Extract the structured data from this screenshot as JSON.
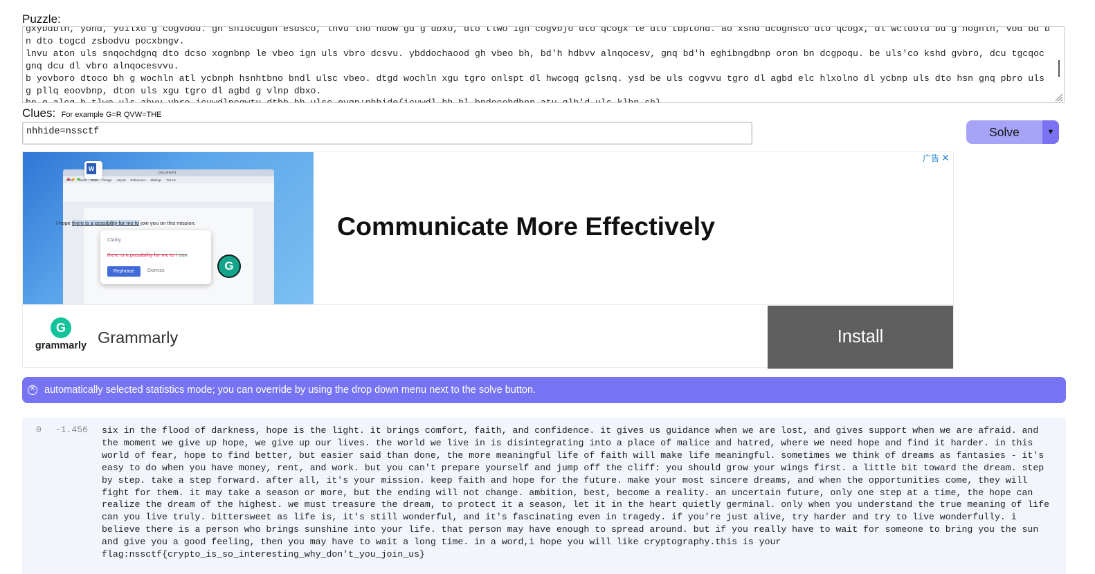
{
  "puzzle": {
    "label": "Puzzle:",
    "text": "gxybdbln, yond, yoilxo g cogvbdu. gn shiocdgbn esdsco, lnvu lno ndow gd g dbxo, dto tlwo ign cogvbjo dto qcogx le dto tbptond. ao xsnd dcognsco dto qcogx, dl wcldold bd g nognln, vod bd bn dto togcd zsbodvu pocxbngv.\nlnvu aton uls snqochdgnq dto dcso xognbnp le vbeo ign uls vbro dcsvu. ybddochaood gh vbeo bh, bd'h hdbvv alnqocesv, gnq bd'h eghibngdbnp oron bn dcgpoqu. be uls'co kshd gvbro, dcu tgcqoc gnq dcu dl vbro alnqocesvvu.\nb yovboro dtoco bh g wochln atl ycbnph hsnhtbno bndl ulsc vbeo. dtgd wochln xgu tgro onlspt dl hwcogq gclsnq. ysd be uls cogvvu tgro dl agbd elc hlxolno dl ycbnp uls dto hsn gnq pbro uls g pllq eoovbnp, dton uls xgu tgro dl agbd g vlnp dbxo.\nbn g alcq,b tlwo uls abvv vbro icuwdlpcgwtu.dtbh bh ulsc evgp:nhhide{icuwdl_bh_hl_bndocohdbnp_atu_qlb'd_uls_klbn_sh}"
  },
  "clues": {
    "label": "Clues:",
    "hint": "For example G=R QVW=THE",
    "value": "nhhide=nssctf"
  },
  "solve": {
    "label": "Solve",
    "dropdown_icon": "triangle-down-icon",
    "dropdown_glyph": "▼"
  },
  "ad": {
    "adchoice_label": "广告",
    "close_glyph": "✕",
    "doc_title": "Document1",
    "doc_tabs": [
      "Home",
      "Insert",
      "Draw",
      "Design",
      "Layout",
      "References",
      "Mailings",
      "Tell me"
    ],
    "doc_word_icon": "W",
    "doc_sentence_before": "I hope ",
    "doc_sentence_highlight": "there is a possibility for me to",
    "doc_sentence_after": " join you on this mission.",
    "card_clarity": "Clarity",
    "card_struck": "there is a possibility for me to",
    "card_replacement": "I can",
    "card_rephrase": "Rephrase",
    "card_dismiss": "Dismiss",
    "badge_letter": "G",
    "headline": "Communicate More Effectively",
    "logo_letter": "G",
    "logo_word": "grammarly",
    "brand": "Grammarly",
    "install": "Install"
  },
  "notice": {
    "icon": "circle-x-icon",
    "glyph": "✕",
    "text": "automatically selected statistics mode; you can override by using the drop down menu next to the solve button."
  },
  "result": {
    "index": "0",
    "score": "-1.456",
    "text": "six in the flood of darkness, hope is the light. it brings comfort, faith, and confidence. it gives us guidance when we are lost, and gives support when we are afraid. and the moment we give up hope, we give up our lives. the world we live in is disintegrating into a place of malice and hatred, where we need hope and find it harder. in this world of fear, hope to find better, but easier said than done, the more meaningful life of faith will make life meaningful. sometimes we think of dreams as fantasies - it's easy to do when you have money, rent, and work. but you can't prepare yourself and jump off the cliff: you should grow your wings first. a little bit toward the dream. step by step. take a step forward. after all, it's your mission. keep faith and hope for the future. make your most sincere dreams, and when the opportunities come, they will fight for them. it may take a season or more, but the ending will not change. ambition, best, become a reality. an uncertain future, only one step at a time, the hope can realize the dream of the highest. we must treasure the dream, to protect it a season, let it in the heart quietly germinal. only when you understand the true meaning of life can you live truly. bittersweet as life is, it's still wonderful, and it's fascinating even in tragedy. if you're just alive, try harder and try to live wonderfully. i believe there is a person who brings sunshine into your life. that person may have enough to spread around. but if you really have to wait for someone to bring you the sun and give you a good feeling, then you may have to wait a long time. in a word,i hope you will like cryptography.this is your flag:nssctf{crypto_is_so_interesting_why_don't_you_join_us}"
  }
}
